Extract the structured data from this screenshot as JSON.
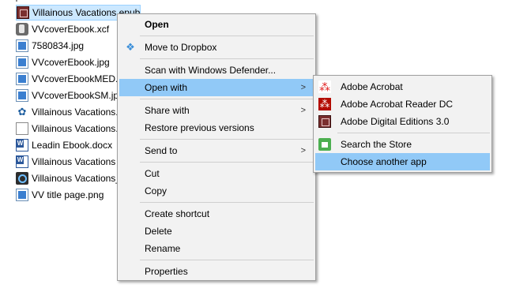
{
  "files": [
    {
      "name": "Villainous Vacations.epub",
      "icon": "epub-icon"
    },
    {
      "name": "VVcoverEbook.xcf",
      "icon": "gimp-xcf-icon"
    },
    {
      "name": "7580834.jpg",
      "icon": "image-icon"
    },
    {
      "name": "VVcoverEbook.jpg",
      "icon": "image-icon"
    },
    {
      "name": "VVcoverEbookMED.jpg",
      "icon": "image-icon"
    },
    {
      "name": "VVcoverEbookSM.jpg",
      "icon": "image-icon"
    },
    {
      "name": "Villainous Vacations.",
      "icon": "scrivener-icon"
    },
    {
      "name": "Villainous Vacations.",
      "icon": "document-icon"
    },
    {
      "name": "Leadin Ebook.docx",
      "icon": "word-icon"
    },
    {
      "name": "Villainous Vacations",
      "icon": "word-icon"
    },
    {
      "name": "Villainous Vacations_",
      "icon": "search-app-icon"
    },
    {
      "name": "VV title page.png",
      "icon": "image-icon"
    }
  ],
  "context_menu": {
    "open": "Open",
    "move_to_dropbox": "Move to Dropbox",
    "scan_defender": "Scan with Windows Defender...",
    "open_with": "Open with",
    "share_with": "Share with",
    "restore_versions": "Restore previous versions",
    "send_to": "Send to",
    "cut": "Cut",
    "copy": "Copy",
    "create_shortcut": "Create shortcut",
    "delete": "Delete",
    "rename": "Rename",
    "properties": "Properties",
    "arrow": ">"
  },
  "open_with_submenu": {
    "adobe_acrobat": "Adobe Acrobat",
    "adobe_reader_dc": "Adobe Acrobat Reader DC",
    "adobe_digital_editions": "Adobe Digital Editions 3.0",
    "search_store": "Search the Store",
    "choose_another_app": "Choose another app"
  },
  "colors": {
    "selection": "#cce8ff",
    "menu_highlight": "#91c9f7",
    "menu_bg": "#f2f2f2"
  }
}
